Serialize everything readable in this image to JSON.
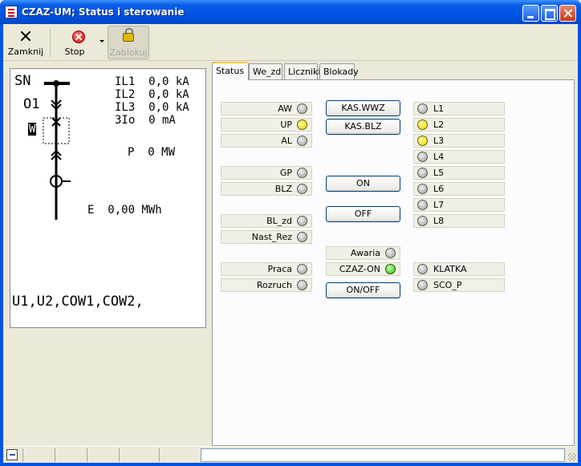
{
  "window": {
    "title": "CZAZ-UM; Status i sterowanie"
  },
  "toolbar": {
    "close_label": "Zamknij",
    "stop_label": "Stop",
    "lock_label": "Zablokuj"
  },
  "schematic": {
    "sn_label": "SN",
    "o1_label": "O1",
    "w_label": "W",
    "measurements": [
      "IL1  0,0 kA",
      "IL2  0,0 kA",
      "IL3  0,0 kA",
      "3Io  0 mA"
    ],
    "power": "P  0 MW",
    "energy": "E  0,00 MWh",
    "footer": "U1,U2,COW1,COW2,"
  },
  "tabs": [
    {
      "label": "Status",
      "active": true
    },
    {
      "label": "We_zd",
      "active": false
    },
    {
      "label": "Liczniki",
      "active": false
    },
    {
      "label": "Blokady",
      "active": false
    }
  ],
  "status": {
    "left_indicators": [
      {
        "label": "AW",
        "state": "off"
      },
      {
        "label": "UP",
        "state": "yellow"
      },
      {
        "label": "AL",
        "state": "off"
      },
      {
        "label": "GP",
        "state": "off"
      },
      {
        "label": "BLZ",
        "state": "off"
      },
      {
        "label": "BL_zd",
        "state": "off"
      },
      {
        "label": "Nast_Rez",
        "state": "off"
      },
      {
        "label": "Praca",
        "state": "off"
      },
      {
        "label": "Rozruch",
        "state": "off"
      }
    ],
    "buttons": {
      "kas_wwz": "KAS.WWZ",
      "kas_blz": "KAS.BLZ",
      "on": "ON",
      "off": "OFF",
      "onoff": "ON/OFF"
    },
    "middle_indicators": [
      {
        "label": "Awaria",
        "state": "off"
      },
      {
        "label": "CZAZ-ON",
        "state": "green"
      }
    ],
    "right_indicators": [
      {
        "label": "L1",
        "state": "off"
      },
      {
        "label": "L2",
        "state": "yellow"
      },
      {
        "label": "L3",
        "state": "yellow"
      },
      {
        "label": "L4",
        "state": "off"
      },
      {
        "label": "L5",
        "state": "off"
      },
      {
        "label": "L6",
        "state": "off"
      },
      {
        "label": "L7",
        "state": "off"
      },
      {
        "label": "L8",
        "state": "off"
      },
      {
        "label": "KLATKA",
        "state": "off"
      },
      {
        "label": "SCO_P",
        "state": "off"
      }
    ]
  }
}
